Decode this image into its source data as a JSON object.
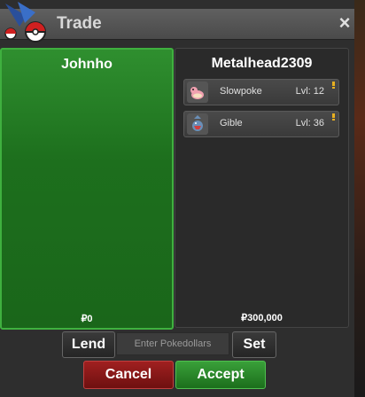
{
  "window": {
    "title": "Trade",
    "close_label": "×"
  },
  "left_panel": {
    "owner": "Johnho",
    "money": "₽0"
  },
  "right_panel": {
    "owner": "Metalhead2309",
    "money": "₽300,000",
    "pokemon": [
      {
        "name": "Slowpoke",
        "level": "Lvl: 12",
        "icon": "slowpoke-sprite-icon"
      },
      {
        "name": "Gible",
        "level": "Lvl: 36",
        "icon": "gible-sprite-icon"
      }
    ]
  },
  "controls": {
    "lend_label": "Lend",
    "money_placeholder": "Enter Pokedollars",
    "set_label": "Set",
    "cancel_label": "Cancel",
    "accept_label": "Accept"
  },
  "colors": {
    "accept": "#2e8b2e",
    "cancel": "#8b1a1a",
    "left_panel": "#1f7a1f"
  }
}
